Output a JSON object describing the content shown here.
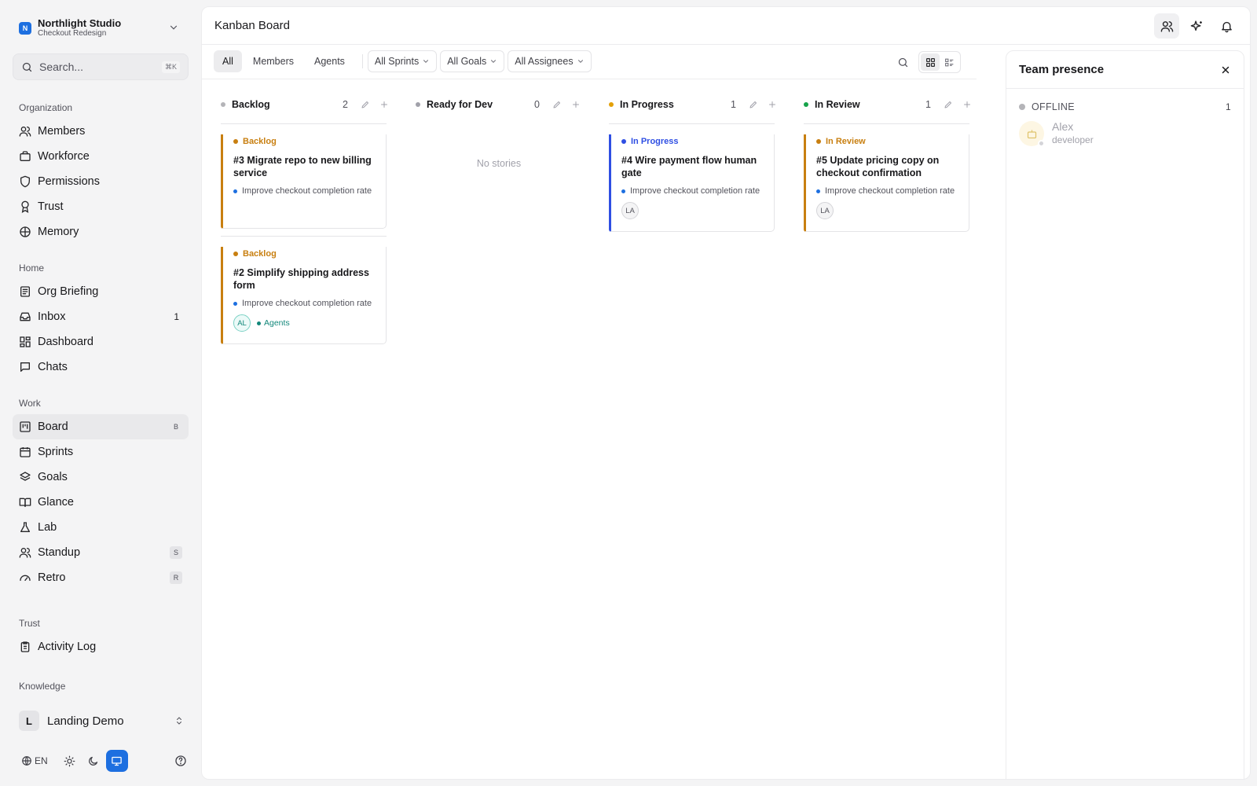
{
  "org": {
    "name": "Northlight Studio",
    "project": "Checkout Redesign",
    "logo_letter": "N"
  },
  "search": {
    "placeholder": "Search...",
    "shortcut": "⌘K"
  },
  "sidebar": {
    "organization": {
      "heading": "Organization",
      "items": [
        {
          "label": "Members",
          "icon": "users-icon"
        },
        {
          "label": "Workforce",
          "icon": "briefcase-icon"
        },
        {
          "label": "Permissions",
          "icon": "shield-icon"
        },
        {
          "label": "Trust",
          "icon": "award-icon"
        },
        {
          "label": "Memory",
          "icon": "brain-icon"
        }
      ]
    },
    "home": {
      "heading": "Home",
      "items": [
        {
          "label": "Org Briefing",
          "icon": "newspaper-icon"
        },
        {
          "label": "Inbox",
          "icon": "inbox-icon",
          "count": "1"
        },
        {
          "label": "Dashboard",
          "icon": "dashboard-icon"
        },
        {
          "label": "Chats",
          "icon": "chat-icon"
        }
      ]
    },
    "work": {
      "heading": "Work",
      "items": [
        {
          "label": "Board",
          "icon": "kanban-icon",
          "shortcut": "B",
          "active": true
        },
        {
          "label": "Sprints",
          "icon": "calendar-icon"
        },
        {
          "label": "Goals",
          "icon": "layers-icon"
        },
        {
          "label": "Glance",
          "icon": "book-open-icon"
        },
        {
          "label": "Lab",
          "icon": "flask-icon"
        },
        {
          "label": "Standup",
          "icon": "users-icon",
          "shortcut": "S"
        },
        {
          "label": "Retro",
          "icon": "gauge-icon",
          "shortcut": "R"
        }
      ]
    },
    "trust": {
      "heading": "Trust",
      "items": [
        {
          "label": "Activity Log",
          "icon": "clipboard-icon"
        }
      ]
    },
    "knowledge": {
      "heading": "Knowledge"
    },
    "workspace": {
      "letter": "L",
      "name": "Landing Demo"
    },
    "language": "EN"
  },
  "header": {
    "title": "Kanban Board"
  },
  "filters": {
    "segments": [
      "All",
      "Members",
      "Agents"
    ],
    "active_segment": "All",
    "dropdowns": [
      "All Sprints",
      "All Goals",
      "All Assignees"
    ]
  },
  "columns": [
    {
      "name": "Backlog",
      "count": "2",
      "dot_color": "#b4b4b8",
      "cards": [
        {
          "status": "Backlog",
          "title": "#3 Migrate repo to new billing service",
          "goal": "Improve checkout completion rate",
          "avatar": "",
          "tag": ""
        },
        {
          "status": "Backlog",
          "title": "#2 Simplify shipping address form",
          "goal": "Improve checkout completion rate",
          "avatar": "AL",
          "tag": "Agents"
        }
      ]
    },
    {
      "name": "Ready for Dev",
      "count": "0",
      "dot_color": "#a1a1aa",
      "empty_text": "No stories",
      "cards": []
    },
    {
      "name": "In Progress",
      "count": "1",
      "dot_color": "#e3a008",
      "cards": [
        {
          "status": "In Progress",
          "title": "#4 Wire payment flow human gate",
          "goal": "Improve checkout completion rate",
          "avatar": "LA"
        }
      ]
    },
    {
      "name": "In Review",
      "count": "1",
      "dot_color": "#16a34a",
      "cards": [
        {
          "status": "In Review",
          "title": "#5 Update pricing copy on checkout confirmation",
          "goal": "Improve checkout completion rate",
          "avatar": "LA"
        }
      ]
    }
  ],
  "presence": {
    "title": "Team presence",
    "group": "OFFLINE",
    "group_count": "1",
    "member": {
      "name": "Alex",
      "role": "developer"
    }
  },
  "colors": {
    "accent": "#1d6fe0",
    "backlog": "#c87f10",
    "in_progress": "#2f4fe3",
    "in_review": "#c87f10",
    "agents": "#12877a"
  }
}
